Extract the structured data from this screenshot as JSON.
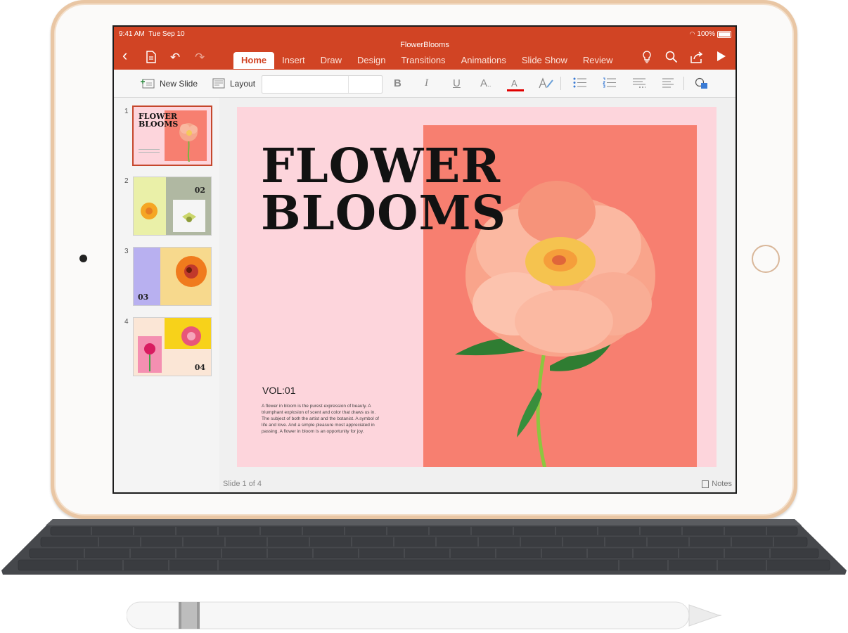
{
  "status_bar": {
    "time": "9:41 AM",
    "date": "Tue Sep 10",
    "battery": "100%"
  },
  "document": {
    "title": "FlowerBlooms"
  },
  "tabs": [
    "Home",
    "Insert",
    "Draw",
    "Design",
    "Transitions",
    "Animations",
    "Slide Show",
    "Review"
  ],
  "active_tab": "Home",
  "ribbon": {
    "new_slide": "New Slide",
    "layout": "Layout",
    "bold": "B",
    "italic": "I",
    "underline": "U",
    "font_size": "A",
    "font_color": "A"
  },
  "thumbnails": [
    {
      "number": "1",
      "title": "FLOWER BLOOMS",
      "selected": true
    },
    {
      "number": "2",
      "label": "02"
    },
    {
      "number": "3",
      "label": "03"
    },
    {
      "number": "4",
      "label": "04"
    }
  ],
  "slide": {
    "title_line1": "FLOWER",
    "title_line2": "BLOOMS",
    "vol": "VOL:01",
    "body": "A flower in bloom is the purest expression of beauty. A triumphant explosion of scent and color that draws us in. The subject of both the artist and the botanist. A symbol of life and love. And a simple pleasure most appreciated in passing. A flower in bloom is an opportunity for joy."
  },
  "footer": {
    "slide_counter": "Slide 1 of 4",
    "notes": "Notes"
  },
  "colors": {
    "accent": "#d14424",
    "slide_pink": "#fdd5dc",
    "slide_coral": "#f77f70",
    "ipad_gold": "#e9c6a4"
  }
}
